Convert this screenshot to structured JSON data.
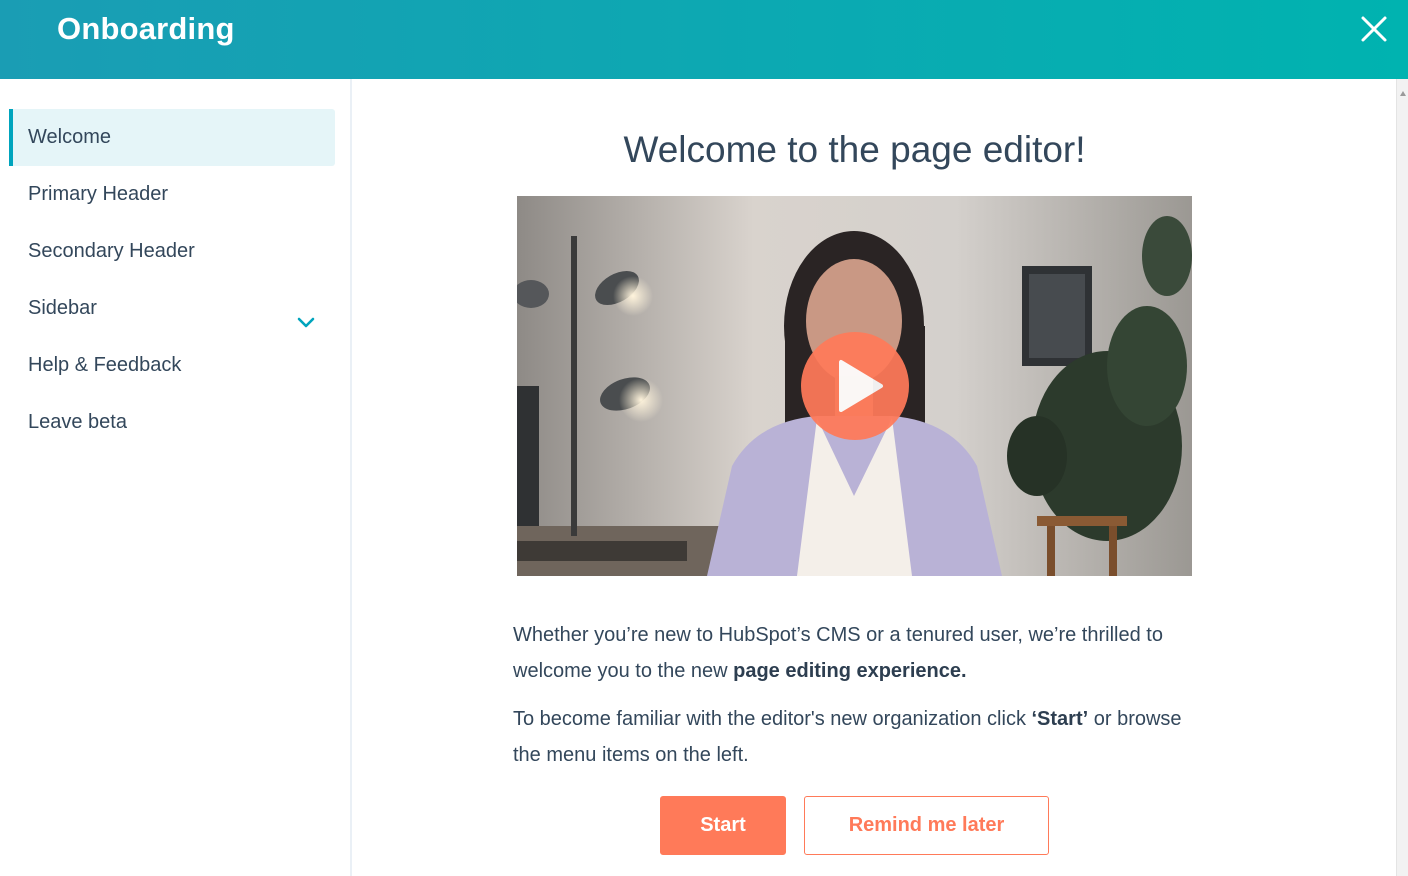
{
  "header": {
    "title": "Onboarding",
    "close_icon": "close-icon",
    "gradient_start": "#1a9db4",
    "gradient_end": "#00b3b0"
  },
  "sidebar": {
    "items": [
      {
        "label": "Welcome",
        "active": true
      },
      {
        "label": "Primary Header",
        "active": false
      },
      {
        "label": "Secondary Header",
        "active": false
      },
      {
        "label": "Sidebar",
        "active": false,
        "icon": "chevron-down-icon"
      },
      {
        "label": "Help & Feedback",
        "active": false
      },
      {
        "label": "Leave beta",
        "active": false
      }
    ],
    "active_accent": "#00a4bd"
  },
  "main": {
    "title": "Welcome to the page editor!",
    "video": {
      "play_icon": "play-icon"
    },
    "paragraph1": {
      "text": "Whether you’re new to HubSpot’s CMS or a tenured user, we’re thrilled to welcome you to the new ",
      "bold": "page editing experience."
    },
    "paragraph2": {
      "text_before": "To become familiar with the editor's new organization click ",
      "bold": "‘Start’",
      "text_after": " or browse the menu items on the left."
    },
    "buttons": {
      "start": "Start",
      "remind_later": "Remind me later"
    },
    "accent_color": "#ff7a59"
  }
}
